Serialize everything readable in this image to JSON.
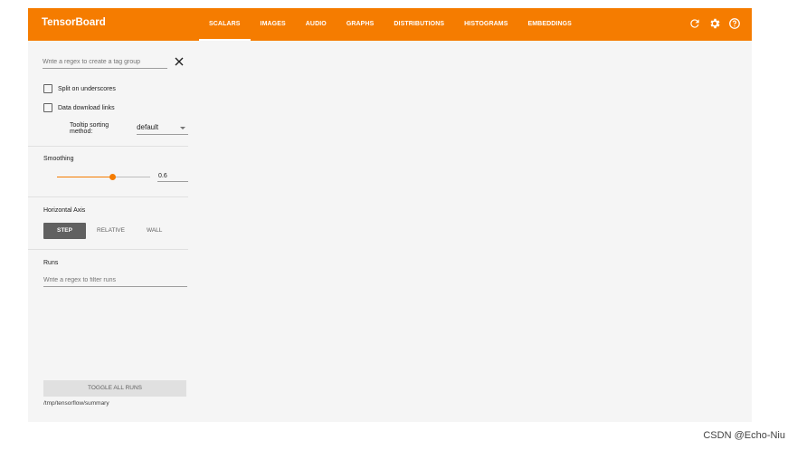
{
  "app": {
    "title": "TensorBoard"
  },
  "tabs": [
    {
      "label": "SCALARS",
      "active": true
    },
    {
      "label": "IMAGES"
    },
    {
      "label": "AUDIO"
    },
    {
      "label": "GRAPHS"
    },
    {
      "label": "DISTRIBUTIONS"
    },
    {
      "label": "HISTOGRAMS"
    },
    {
      "label": "EMBEDDINGS"
    }
  ],
  "toolbar_icons": [
    "refresh-icon",
    "settings-icon",
    "help-icon"
  ],
  "colors": {
    "accent": "#f57c00",
    "background": "#f5f5f5",
    "button_active": "#616161"
  },
  "sidebar": {
    "tag_regex": {
      "placeholder": "Write a regex to create a tag group",
      "value": ""
    },
    "split_underscores": {
      "label": "Split on underscores",
      "checked": false
    },
    "download_links": {
      "label": "Data download links",
      "checked": false
    },
    "tooltip_sorting": {
      "label": "Tooltip sorting method:",
      "value": "default"
    },
    "smoothing": {
      "title": "Smoothing",
      "value": "0.6",
      "level": 0.6
    },
    "horizontal_axis": {
      "title": "Horizontal Axis",
      "options": [
        {
          "label": "STEP",
          "active": true
        },
        {
          "label": "RELATIVE"
        },
        {
          "label": "WALL"
        }
      ]
    },
    "runs": {
      "title": "Runs",
      "filter_placeholder": "Write a regex to filter runs",
      "toggle_label": "TOGGLE ALL RUNS",
      "path": "/tmp/tensorflow/summary"
    }
  },
  "watermark": "CSDN @Echo-Niu"
}
